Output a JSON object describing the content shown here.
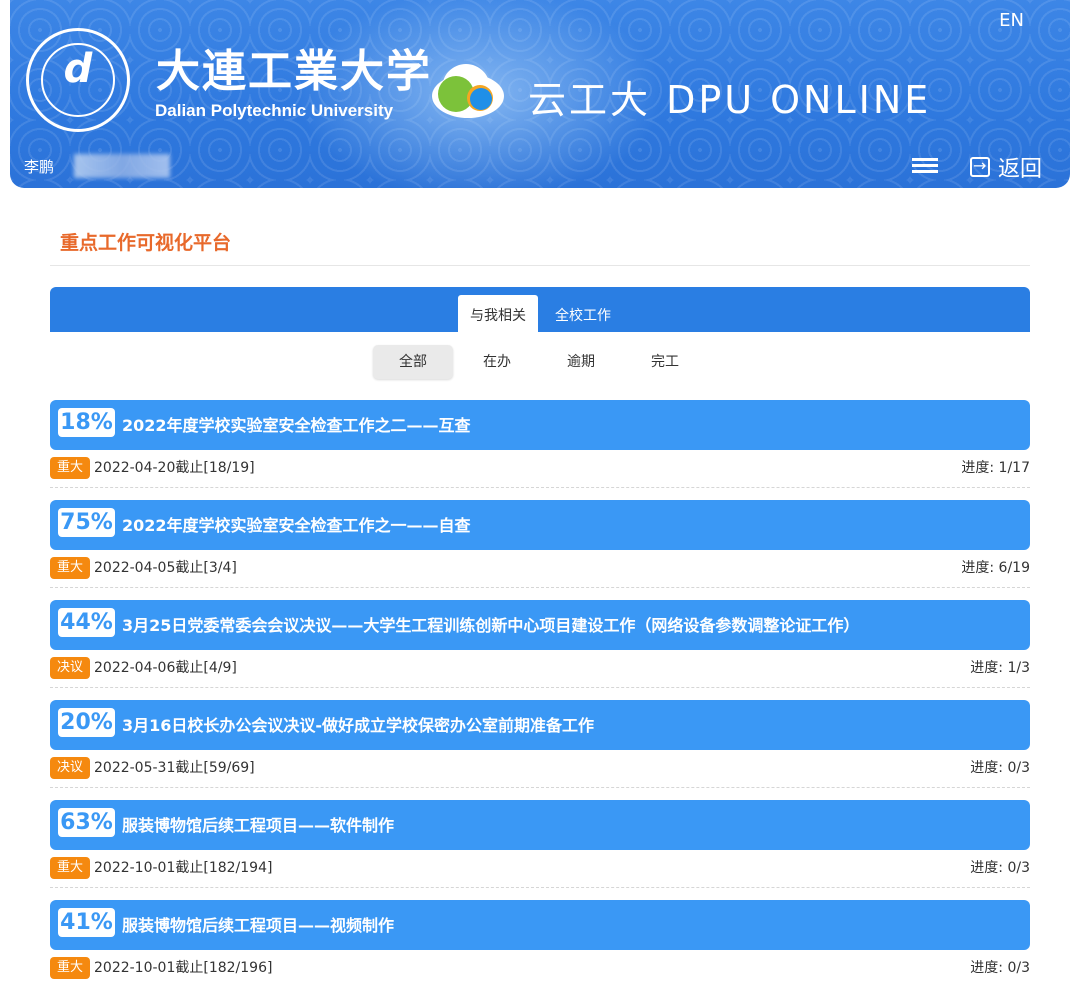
{
  "header": {
    "lang_toggle": "EN",
    "university_cn": "大連工業大学",
    "university_en": "Dalian Polytechnic University",
    "platform_name": "云工大 DPU ONLINE",
    "user_name": "李鹏",
    "back_label": "返回",
    "colors": {
      "banner": "#2f79df",
      "cloud_green": "#7cc23a",
      "cloud_blue": "#1f8fe8"
    }
  },
  "page": {
    "title": "重点工作可视化平台",
    "title_color": "#e8692b"
  },
  "tabs": [
    {
      "label": "与我相关",
      "active": true
    },
    {
      "label": "全校工作",
      "active": false
    }
  ],
  "filters": [
    {
      "label": "全部",
      "active": true
    },
    {
      "label": "在办",
      "active": false
    },
    {
      "label": "逾期",
      "active": false
    },
    {
      "label": "完工",
      "active": false
    }
  ],
  "tasks": [
    {
      "percent": "18%",
      "title": "2022年度学校实验室安全检查工作之二——互查",
      "badge": "重大",
      "deadline": "2022-04-20截止[18/19]",
      "progress": "进度: 1/17"
    },
    {
      "percent": "75%",
      "title": "2022年度学校实验室安全检查工作之一——自查",
      "badge": "重大",
      "deadline": "2022-04-05截止[3/4]",
      "progress": "进度: 6/19"
    },
    {
      "percent": "44%",
      "title": "3月25日党委常委会会议决议——大学生工程训练创新中心项目建设工作（网络设备参数调整论证工作）",
      "badge": "决议",
      "deadline": "2022-04-06截止[4/9]",
      "progress": "进度: 1/3"
    },
    {
      "percent": "20%",
      "title": "3月16日校长办公会议决议-做好成立学校保密办公室前期准备工作",
      "badge": "决议",
      "deadline": "2022-05-31截止[59/69]",
      "progress": "进度: 0/3"
    },
    {
      "percent": "63%",
      "title": "服装博物馆后续工程项目——软件制作",
      "badge": "重大",
      "deadline": "2022-10-01截止[182/194]",
      "progress": "进度: 0/3"
    },
    {
      "percent": "41%",
      "title": "服装博物馆后续工程项目——视频制作",
      "badge": "重大",
      "deadline": "2022-10-01截止[182/196]",
      "progress": "进度: 0/3"
    }
  ]
}
